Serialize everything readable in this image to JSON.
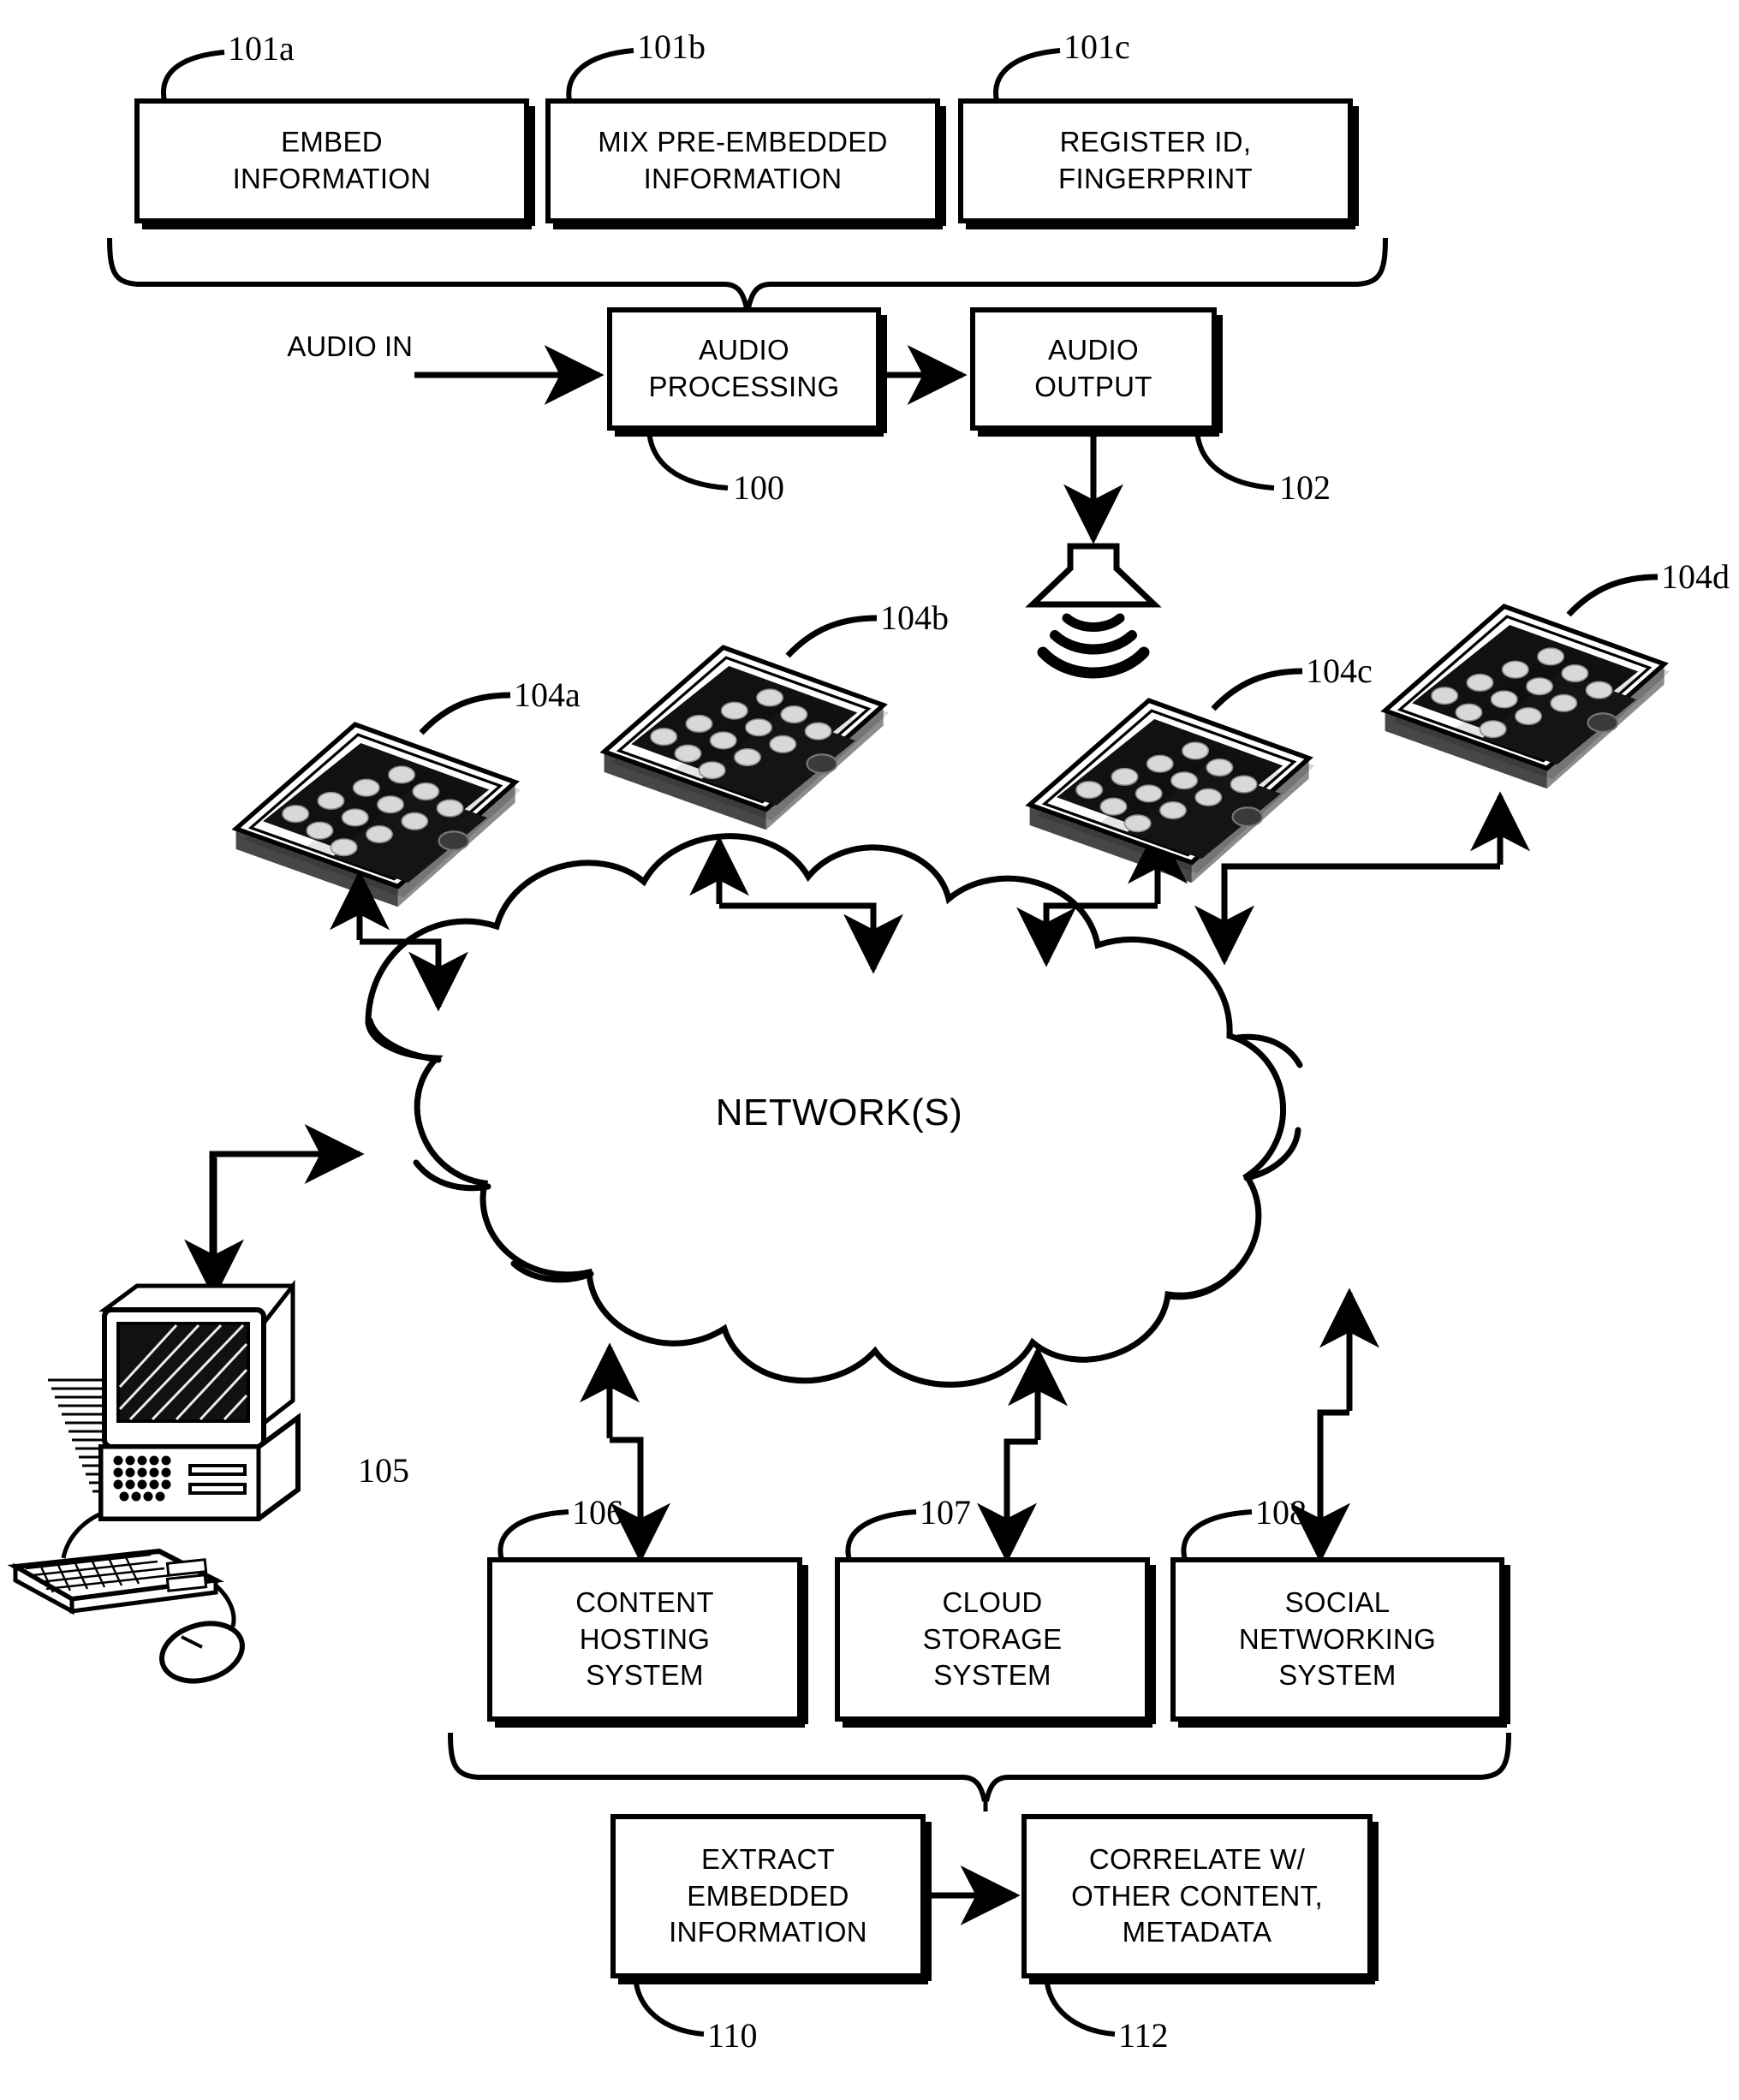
{
  "figure": {
    "type": "patent-flow-diagram",
    "background": "#ffffff",
    "ink": "#000000"
  },
  "top_processes": [
    {
      "ref": "101a",
      "label": "EMBED\nINFORMATION"
    },
    {
      "ref": "101b",
      "label": "MIX PRE-EMBEDDED\nINFORMATION"
    },
    {
      "ref": "101c",
      "label": "REGISTER ID,\nFINGERPRINT"
    }
  ],
  "audio_chain": {
    "input_label": "AUDIO IN",
    "processing": {
      "ref": "100",
      "label": "AUDIO\nPROCESSING"
    },
    "output": {
      "ref": "102",
      "label": "AUDIO\nOUTPUT"
    },
    "speaker_icon": "loudspeaker-icon"
  },
  "devices": [
    {
      "ref": "104a",
      "icon": "smartphone-icon"
    },
    {
      "ref": "104b",
      "icon": "smartphone-icon"
    },
    {
      "ref": "104c",
      "icon": "smartphone-icon"
    },
    {
      "ref": "104d",
      "icon": "smartphone-icon"
    }
  ],
  "network": {
    "label": "NETWORK(S)",
    "icon": "cloud-icon"
  },
  "workstation": {
    "ref": "105",
    "icon": "desktop-computer-icon"
  },
  "backend_systems": [
    {
      "ref": "106",
      "label": "CONTENT\nHOSTING\nSYSTEM"
    },
    {
      "ref": "107",
      "label": "CLOUD\nSTORAGE\nSYSTEM"
    },
    {
      "ref": "108",
      "label": "SOCIAL\nNETWORKING\nSYSTEM"
    }
  ],
  "bottom_processes": [
    {
      "ref": "110",
      "label": "EXTRACT\nEMBEDDED\nINFORMATION"
    },
    {
      "ref": "112",
      "label": "CORRELATE W/\nOTHER CONTENT,\nMETADATA"
    }
  ]
}
